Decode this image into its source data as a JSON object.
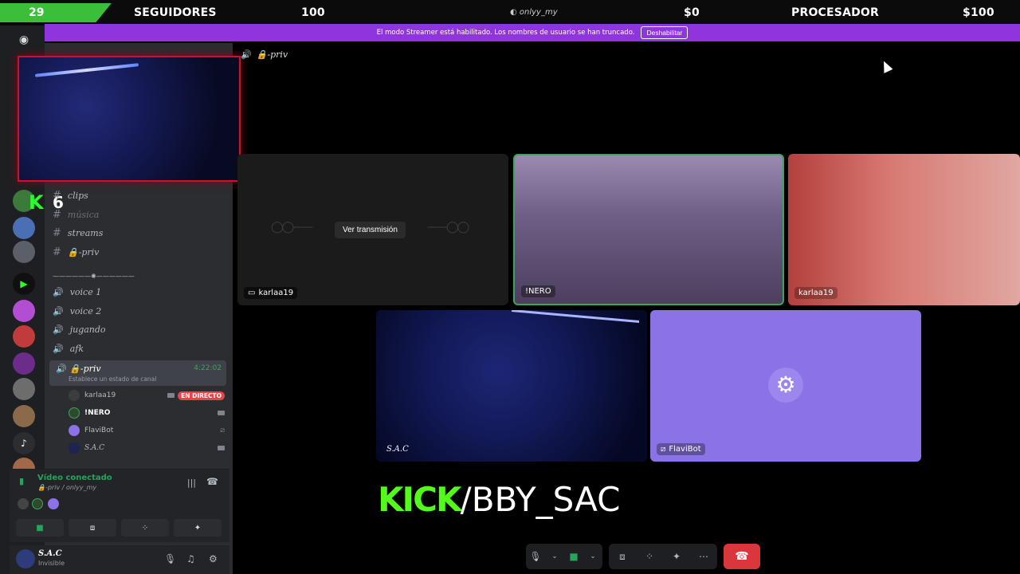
{
  "overlay_stats": {
    "followers_count": "29",
    "followers_label": "SEGUIDORES",
    "goal_count": "100",
    "handle": "onlyy_my",
    "money": "$0",
    "processor_label": "PROCESADOR",
    "money_goal": "$100"
  },
  "banner": {
    "text": "El modo Streamer está habilitado. Los nombres de usuario se han truncado.",
    "button_label": "Deshabilitar"
  },
  "sidebar_badge": "6",
  "channels": {
    "items": [
      {
        "type": "text",
        "label": "clips",
        "dim": false
      },
      {
        "type": "text",
        "label": "música",
        "dim": true
      },
      {
        "type": "text",
        "label": "streams",
        "dim": false
      },
      {
        "type": "text",
        "label": "🔒-priv",
        "dim": false
      }
    ],
    "category_label": "——————✺——————",
    "voice": [
      "voice 1",
      "voice 2",
      "jugando",
      "afk"
    ]
  },
  "active_channel": {
    "name": "🔒-priv",
    "time": "4:22:02",
    "status_prompt": "Establece un estado de canal"
  },
  "members": [
    {
      "name": "karlaa19",
      "live_badge": "EN DIRECTO",
      "icon": "camera-icon"
    },
    {
      "name": "!NERO",
      "live_badge": "",
      "icon": "camera-icon"
    },
    {
      "name": "FlaviBot",
      "live_badge": "",
      "icon": "stream-icon"
    },
    {
      "name": "S.A.C",
      "live_badge": "",
      "icon": "camera-icon"
    }
  ],
  "voice_panel": {
    "title": "Vídeo conectado",
    "subtitle": "🔒-priv / onlyy_my"
  },
  "user_panel": {
    "name": "S.A.C",
    "status": "Invisible"
  },
  "main": {
    "channel_title": "🔒-priv",
    "stream_button": "Ver transmisión",
    "tiles": [
      {
        "label": "karlaa19"
      },
      {
        "label": "!NERO"
      },
      {
        "label": "karlaa19"
      },
      {
        "label": "S.A.C"
      },
      {
        "label": "FlaviBot"
      }
    ]
  },
  "kick_brand": {
    "word": "KICK",
    "path": "/BBY_SAC"
  },
  "colors": {
    "accent_purple": "#8f35dd",
    "kick_green": "#53fc18",
    "live_red": "#ed4245",
    "hangup_red": "#da373c",
    "flavibot_tile": "#8b72e6"
  }
}
